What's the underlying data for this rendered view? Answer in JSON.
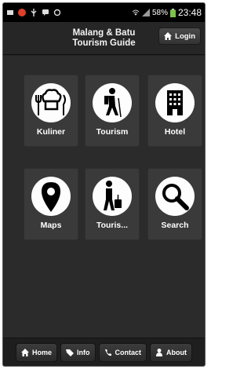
{
  "status_bar": {
    "battery": "58%",
    "time": "23:48"
  },
  "header": {
    "title": "Malang & Batu\nTourism Guide",
    "login_label": "Login"
  },
  "tiles": [
    {
      "label": "Kuliner",
      "icon": "chef-hat-icon"
    },
    {
      "label": "Tourism",
      "icon": "hiker-icon"
    },
    {
      "label": "Hotel",
      "icon": "building-icon"
    },
    {
      "label": "Maps",
      "icon": "map-pin-icon"
    },
    {
      "label": "Touris...",
      "icon": "traveler-luggage-icon"
    },
    {
      "label": "Search",
      "icon": "magnifier-icon"
    }
  ],
  "footer": {
    "home": "Home",
    "info": "Info",
    "contact": "Contact",
    "about": "About"
  }
}
